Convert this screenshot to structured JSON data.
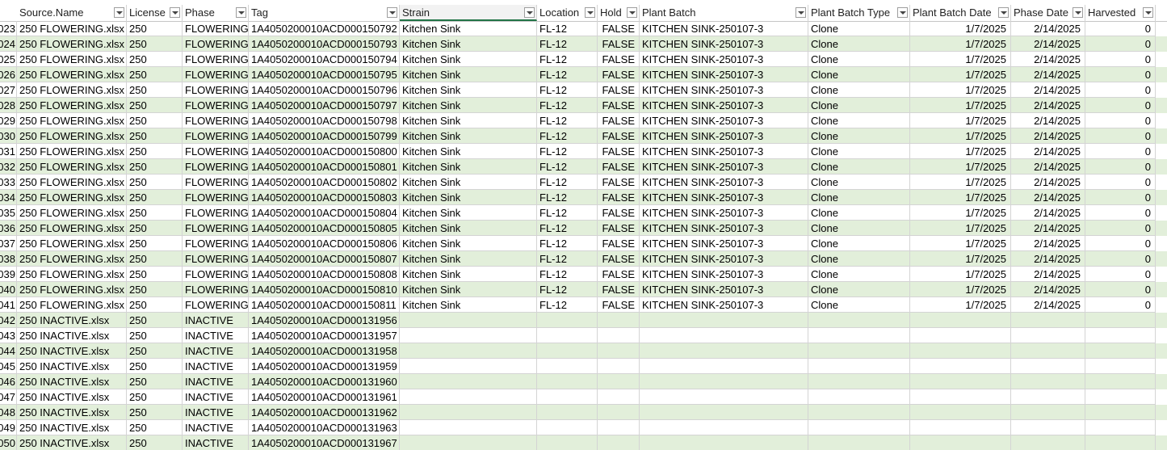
{
  "columns": [
    {
      "label": "Source.Name",
      "key": "source"
    },
    {
      "label": "License",
      "key": "license"
    },
    {
      "label": "Phase",
      "key": "phase"
    },
    {
      "label": "Tag",
      "key": "tag"
    },
    {
      "label": "Strain",
      "key": "strain"
    },
    {
      "label": "Location",
      "key": "location"
    },
    {
      "label": "Hold",
      "key": "hold"
    },
    {
      "label": "Plant Batch",
      "key": "batch"
    },
    {
      "label": "Plant Batch Type",
      "key": "batch_type"
    },
    {
      "label": "Plant Batch Date",
      "key": "batch_date"
    },
    {
      "label": "Phase Date",
      "key": "phase_date"
    },
    {
      "label": "Harvested",
      "key": "harvested"
    }
  ],
  "rows": [
    {
      "rn": "023",
      "source": "250 FLOWERING.xlsx",
      "license": "250",
      "phase": "FLOWERING",
      "tag": "1A4050200010ACD000150792",
      "strain": "Kitchen Sink",
      "location": "FL-12",
      "hold": "FALSE",
      "batch": "KITCHEN SINK-250107-3",
      "batch_type": "Clone",
      "batch_date": "1/7/2025",
      "phase_date": "2/14/2025",
      "harvested": "0"
    },
    {
      "rn": "024",
      "source": "250 FLOWERING.xlsx",
      "license": "250",
      "phase": "FLOWERING",
      "tag": "1A4050200010ACD000150793",
      "strain": "Kitchen Sink",
      "location": "FL-12",
      "hold": "FALSE",
      "batch": "KITCHEN SINK-250107-3",
      "batch_type": "Clone",
      "batch_date": "1/7/2025",
      "phase_date": "2/14/2025",
      "harvested": "0"
    },
    {
      "rn": "025",
      "source": "250 FLOWERING.xlsx",
      "license": "250",
      "phase": "FLOWERING",
      "tag": "1A4050200010ACD000150794",
      "strain": "Kitchen Sink",
      "location": "FL-12",
      "hold": "FALSE",
      "batch": "KITCHEN SINK-250107-3",
      "batch_type": "Clone",
      "batch_date": "1/7/2025",
      "phase_date": "2/14/2025",
      "harvested": "0"
    },
    {
      "rn": "026",
      "source": "250 FLOWERING.xlsx",
      "license": "250",
      "phase": "FLOWERING",
      "tag": "1A4050200010ACD000150795",
      "strain": "Kitchen Sink",
      "location": "FL-12",
      "hold": "FALSE",
      "batch": "KITCHEN SINK-250107-3",
      "batch_type": "Clone",
      "batch_date": "1/7/2025",
      "phase_date": "2/14/2025",
      "harvested": "0"
    },
    {
      "rn": "027",
      "source": "250 FLOWERING.xlsx",
      "license": "250",
      "phase": "FLOWERING",
      "tag": "1A4050200010ACD000150796",
      "strain": "Kitchen Sink",
      "location": "FL-12",
      "hold": "FALSE",
      "batch": "KITCHEN SINK-250107-3",
      "batch_type": "Clone",
      "batch_date": "1/7/2025",
      "phase_date": "2/14/2025",
      "harvested": "0"
    },
    {
      "rn": "028",
      "source": "250 FLOWERING.xlsx",
      "license": "250",
      "phase": "FLOWERING",
      "tag": "1A4050200010ACD000150797",
      "strain": "Kitchen Sink",
      "location": "FL-12",
      "hold": "FALSE",
      "batch": "KITCHEN SINK-250107-3",
      "batch_type": "Clone",
      "batch_date": "1/7/2025",
      "phase_date": "2/14/2025",
      "harvested": "0"
    },
    {
      "rn": "029",
      "source": "250 FLOWERING.xlsx",
      "license": "250",
      "phase": "FLOWERING",
      "tag": "1A4050200010ACD000150798",
      "strain": "Kitchen Sink",
      "location": "FL-12",
      "hold": "FALSE",
      "batch": "KITCHEN SINK-250107-3",
      "batch_type": "Clone",
      "batch_date": "1/7/2025",
      "phase_date": "2/14/2025",
      "harvested": "0"
    },
    {
      "rn": "030",
      "source": "250 FLOWERING.xlsx",
      "license": "250",
      "phase": "FLOWERING",
      "tag": "1A4050200010ACD000150799",
      "strain": "Kitchen Sink",
      "location": "FL-12",
      "hold": "FALSE",
      "batch": "KITCHEN SINK-250107-3",
      "batch_type": "Clone",
      "batch_date": "1/7/2025",
      "phase_date": "2/14/2025",
      "harvested": "0"
    },
    {
      "rn": "031",
      "source": "250 FLOWERING.xlsx",
      "license": "250",
      "phase": "FLOWERING",
      "tag": "1A4050200010ACD000150800",
      "strain": "Kitchen Sink",
      "location": "FL-12",
      "hold": "FALSE",
      "batch": "KITCHEN SINK-250107-3",
      "batch_type": "Clone",
      "batch_date": "1/7/2025",
      "phase_date": "2/14/2025",
      "harvested": "0"
    },
    {
      "rn": "032",
      "source": "250 FLOWERING.xlsx",
      "license": "250",
      "phase": "FLOWERING",
      "tag": "1A4050200010ACD000150801",
      "strain": "Kitchen Sink",
      "location": "FL-12",
      "hold": "FALSE",
      "batch": "KITCHEN SINK-250107-3",
      "batch_type": "Clone",
      "batch_date": "1/7/2025",
      "phase_date": "2/14/2025",
      "harvested": "0"
    },
    {
      "rn": "033",
      "source": "250 FLOWERING.xlsx",
      "license": "250",
      "phase": "FLOWERING",
      "tag": "1A4050200010ACD000150802",
      "strain": "Kitchen Sink",
      "location": "FL-12",
      "hold": "FALSE",
      "batch": "KITCHEN SINK-250107-3",
      "batch_type": "Clone",
      "batch_date": "1/7/2025",
      "phase_date": "2/14/2025",
      "harvested": "0"
    },
    {
      "rn": "034",
      "source": "250 FLOWERING.xlsx",
      "license": "250",
      "phase": "FLOWERING",
      "tag": "1A4050200010ACD000150803",
      "strain": "Kitchen Sink",
      "location": "FL-12",
      "hold": "FALSE",
      "batch": "KITCHEN SINK-250107-3",
      "batch_type": "Clone",
      "batch_date": "1/7/2025",
      "phase_date": "2/14/2025",
      "harvested": "0"
    },
    {
      "rn": "035",
      "source": "250 FLOWERING.xlsx",
      "license": "250",
      "phase": "FLOWERING",
      "tag": "1A4050200010ACD000150804",
      "strain": "Kitchen Sink",
      "location": "FL-12",
      "hold": "FALSE",
      "batch": "KITCHEN SINK-250107-3",
      "batch_type": "Clone",
      "batch_date": "1/7/2025",
      "phase_date": "2/14/2025",
      "harvested": "0"
    },
    {
      "rn": "036",
      "source": "250 FLOWERING.xlsx",
      "license": "250",
      "phase": "FLOWERING",
      "tag": "1A4050200010ACD000150805",
      "strain": "Kitchen Sink",
      "location": "FL-12",
      "hold": "FALSE",
      "batch": "KITCHEN SINK-250107-3",
      "batch_type": "Clone",
      "batch_date": "1/7/2025",
      "phase_date": "2/14/2025",
      "harvested": "0"
    },
    {
      "rn": "037",
      "source": "250 FLOWERING.xlsx",
      "license": "250",
      "phase": "FLOWERING",
      "tag": "1A4050200010ACD000150806",
      "strain": "Kitchen Sink",
      "location": "FL-12",
      "hold": "FALSE",
      "batch": "KITCHEN SINK-250107-3",
      "batch_type": "Clone",
      "batch_date": "1/7/2025",
      "phase_date": "2/14/2025",
      "harvested": "0"
    },
    {
      "rn": "038",
      "source": "250 FLOWERING.xlsx",
      "license": "250",
      "phase": "FLOWERING",
      "tag": "1A4050200010ACD000150807",
      "strain": "Kitchen Sink",
      "location": "FL-12",
      "hold": "FALSE",
      "batch": "KITCHEN SINK-250107-3",
      "batch_type": "Clone",
      "batch_date": "1/7/2025",
      "phase_date": "2/14/2025",
      "harvested": "0"
    },
    {
      "rn": "039",
      "source": "250 FLOWERING.xlsx",
      "license": "250",
      "phase": "FLOWERING",
      "tag": "1A4050200010ACD000150808",
      "strain": "Kitchen Sink",
      "location": "FL-12",
      "hold": "FALSE",
      "batch": "KITCHEN SINK-250107-3",
      "batch_type": "Clone",
      "batch_date": "1/7/2025",
      "phase_date": "2/14/2025",
      "harvested": "0"
    },
    {
      "rn": "040",
      "source": "250 FLOWERING.xlsx",
      "license": "250",
      "phase": "FLOWERING",
      "tag": "1A4050200010ACD000150810",
      "strain": "Kitchen Sink",
      "location": "FL-12",
      "hold": "FALSE",
      "batch": "KITCHEN SINK-250107-3",
      "batch_type": "Clone",
      "batch_date": "1/7/2025",
      "phase_date": "2/14/2025",
      "harvested": "0"
    },
    {
      "rn": "041",
      "source": "250 FLOWERING.xlsx",
      "license": "250",
      "phase": "FLOWERING",
      "tag": "1A4050200010ACD000150811",
      "strain": "Kitchen Sink",
      "location": "FL-12",
      "hold": "FALSE",
      "batch": "KITCHEN SINK-250107-3",
      "batch_type": "Clone",
      "batch_date": "1/7/2025",
      "phase_date": "2/14/2025",
      "harvested": "0"
    },
    {
      "rn": "042",
      "source": "250 INACTIVE.xlsx",
      "license": "250",
      "phase": "INACTIVE",
      "tag": "1A4050200010ACD000131956"
    },
    {
      "rn": "043",
      "source": "250 INACTIVE.xlsx",
      "license": "250",
      "phase": "INACTIVE",
      "tag": "1A4050200010ACD000131957"
    },
    {
      "rn": "044",
      "source": "250 INACTIVE.xlsx",
      "license": "250",
      "phase": "INACTIVE",
      "tag": "1A4050200010ACD000131958"
    },
    {
      "rn": "045",
      "source": "250 INACTIVE.xlsx",
      "license": "250",
      "phase": "INACTIVE",
      "tag": "1A4050200010ACD000131959"
    },
    {
      "rn": "046",
      "source": "250 INACTIVE.xlsx",
      "license": "250",
      "phase": "INACTIVE",
      "tag": "1A4050200010ACD000131960"
    },
    {
      "rn": "047",
      "source": "250 INACTIVE.xlsx",
      "license": "250",
      "phase": "INACTIVE",
      "tag": "1A4050200010ACD000131961"
    },
    {
      "rn": "048",
      "source": "250 INACTIVE.xlsx",
      "license": "250",
      "phase": "INACTIVE",
      "tag": "1A4050200010ACD000131962"
    },
    {
      "rn": "049",
      "source": "250 INACTIVE.xlsx",
      "license": "250",
      "phase": "INACTIVE",
      "tag": "1A4050200010ACD000131963"
    },
    {
      "rn": "050",
      "source": "250 INACTIVE.xlsx",
      "license": "250",
      "phase": "INACTIVE",
      "tag": "1A4050200010ACD000131967"
    }
  ]
}
